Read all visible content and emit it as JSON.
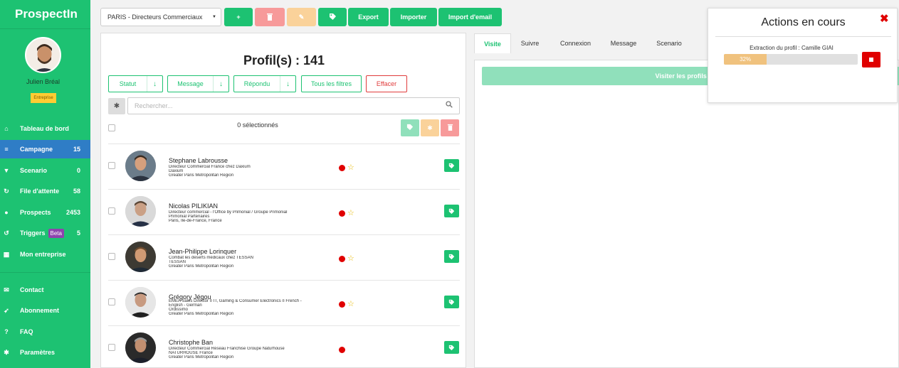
{
  "app": {
    "name": "ProspectIn"
  },
  "user": {
    "name": "Julien Bréal",
    "plan": "Entreprise"
  },
  "sidebar": {
    "items": [
      {
        "label": "Tableau de bord",
        "count": "",
        "icon": "home-icon",
        "glyph": "⌂",
        "active": false
      },
      {
        "label": "Campagne",
        "count": "15",
        "icon": "list-icon",
        "glyph": "≡",
        "active": true
      },
      {
        "label": "Scenario",
        "count": "0",
        "icon": "filter-icon",
        "glyph": "▼",
        "active": false
      },
      {
        "label": "File d'attente",
        "count": "58",
        "icon": "refresh-icon",
        "glyph": "↻",
        "active": false
      },
      {
        "label": "Prospects",
        "count": "2453",
        "icon": "user-icon",
        "glyph": "●",
        "active": false
      },
      {
        "label": "Triggers",
        "count": "5",
        "beta": "Beta",
        "icon": "history-icon",
        "glyph": "↺",
        "active": false
      },
      {
        "label": "Mon entreprise",
        "count": "",
        "icon": "building-icon",
        "glyph": "▦",
        "active": false
      }
    ],
    "bottom_items": [
      {
        "label": "Contact",
        "icon": "envelope-icon",
        "glyph": "✉"
      },
      {
        "label": "Abonnement",
        "icon": "rocket-icon",
        "glyph": "➶"
      },
      {
        "label": "FAQ",
        "icon": "question-icon",
        "glyph": "?"
      },
      {
        "label": "Paramètres",
        "icon": "gear-icon",
        "glyph": "✱"
      }
    ]
  },
  "toolbar": {
    "campaign_select": "PARIS - Directeurs Commerciaux",
    "add_label": "+",
    "delete_label": "🗑",
    "edit_label": "✎",
    "tag_label": "🏷",
    "export_label": "Export",
    "import_label": "Importer",
    "import_email_label": "Import d'email"
  },
  "main": {
    "title": "Profil(s) : 141",
    "filters": {
      "statut": "Statut",
      "message": "Message",
      "repondu": "Répondu",
      "all_filters": "Tous les filtres",
      "clear": "Effacer"
    },
    "search_placeholder": "Rechercher...",
    "selected_text": "0 sélectionnés",
    "profiles": [
      {
        "name": "Stephane Labrousse",
        "lines": [
          "Directeur Commercial France chez Daxium",
          "Daxium",
          "Greater Paris Metropolitan Region"
        ],
        "starred": true
      },
      {
        "name": "Nicolas PILIKIAN",
        "lines": [
          "Directeur commercial - l'Office by Primonial / Groupe Primonial",
          "Primonial Partenaires",
          "Paris, Île-de-France, France"
        ],
        "starred": true
      },
      {
        "name": "Jean-Philippe Lorinquer",
        "lines": [
          "Combat les déserts médicaux chez TESSAN",
          "TESSAN",
          "Greater Paris Metropolitan Region"
        ],
        "starred": true
      },
      {
        "name": "Grégory Jégou",
        "lines": [
          "EMEA Sales Director ¤ IT, Gaming & Consumer Electronics ¤ French -",
          "English - German",
          "Ordissimo",
          "Greater Paris Metropolitan Region"
        ],
        "starred": true
      },
      {
        "name": "Christophe Ban",
        "lines": [
          "Directeur Commercial Réseau Franchise Groupe Naturhouse",
          "NATURHOUSE France",
          "Greater Paris Metropolitan Region"
        ],
        "starred": false
      }
    ]
  },
  "right": {
    "tabs": [
      "Visite",
      "Suivre",
      "Connexion",
      "Message",
      "Scenario"
    ],
    "visit_button": "Visiter les profils sélecti"
  },
  "actions": {
    "title": "Actions en cours",
    "close_glyph": "✖",
    "extract_label": "Extraction du profil : Camille GIAI",
    "progress_text": "32%",
    "progress_value": 32
  },
  "colors": {
    "accent": "#1dc272",
    "active_nav": "#2f7dc6",
    "danger": "#e00000",
    "progress": "#f0c27e"
  }
}
